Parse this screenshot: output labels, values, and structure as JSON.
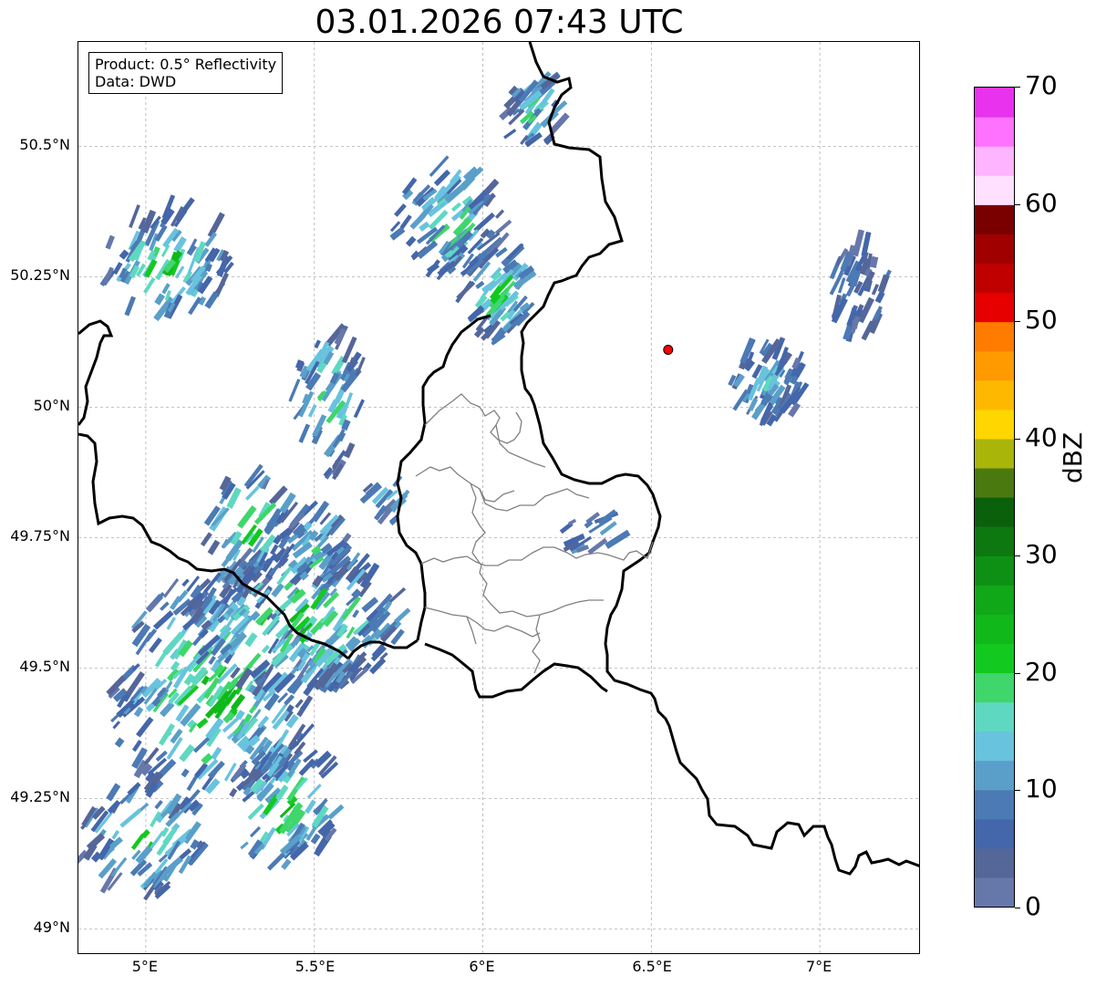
{
  "title": "03.01.2026 07:43 UTC",
  "info": {
    "product": "Product: 0.5° Reflectivity",
    "data": "Data: DWD"
  },
  "map": {
    "lon_range": [
      4.8,
      7.3
    ],
    "lat_range": [
      48.95,
      50.7
    ],
    "lat_ticks": [
      {
        "value": 50.5,
        "label": "50.5°N"
      },
      {
        "value": 50.25,
        "label": "50.25°N"
      },
      {
        "value": 50.0,
        "label": "50°N"
      },
      {
        "value": 49.75,
        "label": "49.75°N"
      },
      {
        "value": 49.5,
        "label": "49.5°N"
      },
      {
        "value": 49.25,
        "label": "49.25°N"
      },
      {
        "value": 49.0,
        "label": "49°N"
      }
    ],
    "lon_ticks": [
      {
        "value": 5.0,
        "label": "5°E"
      },
      {
        "value": 5.5,
        "label": "5.5°E"
      },
      {
        "value": 6.0,
        "label": "6°E"
      },
      {
        "value": 6.5,
        "label": "6.5°E"
      },
      {
        "value": 7.0,
        "label": "7°E"
      }
    ],
    "radar_site": {
      "lon": 6.55,
      "lat": 50.11,
      "color": "#ff0000"
    }
  },
  "colorbar": {
    "label": "dBZ",
    "min": 0,
    "max": 70,
    "ticks": [
      "0",
      "10",
      "20",
      "30",
      "40",
      "50",
      "60",
      "70"
    ],
    "colors": [
      "#6677aa",
      "#556699",
      "#4466aa",
      "#4c7ab4",
      "#5a9fc9",
      "#68c3de",
      "#5fd8c1",
      "#3fd66b",
      "#12c920",
      "#10b81a",
      "#10a818",
      "#0e9014",
      "#0c780f",
      "#0a600b",
      "#4a7a0f",
      "#aab50a",
      "#ffd600",
      "#ffb800",
      "#ff9a00",
      "#ff7c00",
      "#e60000",
      "#c00000",
      "#a00000",
      "#7a0000",
      "#ffe0ff",
      "#ffb4ff",
      "#ff72ff",
      "#e832ee"
    ]
  }
}
